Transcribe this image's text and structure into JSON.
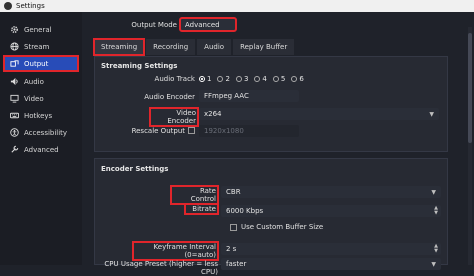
{
  "window": {
    "title": "Settings"
  },
  "sidebar": {
    "items": [
      {
        "label": "General",
        "icon": "gear-icon"
      },
      {
        "label": "Stream",
        "icon": "globe-icon"
      },
      {
        "label": "Output",
        "icon": "output-icon"
      },
      {
        "label": "Audio",
        "icon": "speaker-icon"
      },
      {
        "label": "Video",
        "icon": "monitor-icon"
      },
      {
        "label": "Hotkeys",
        "icon": "keyboard-icon"
      },
      {
        "label": "Accessibility",
        "icon": "accessibility-icon"
      },
      {
        "label": "Advanced",
        "icon": "wrench-icon"
      }
    ],
    "active_index": 2
  },
  "output_mode": {
    "label": "Output Mode",
    "value": "Advanced"
  },
  "tabs": [
    {
      "label": "Streaming"
    },
    {
      "label": "Recording"
    },
    {
      "label": "Audio"
    },
    {
      "label": "Replay Buffer"
    }
  ],
  "streaming_settings": {
    "title": "Streaming Settings",
    "audio_track": {
      "label": "Audio Track",
      "options": [
        "1",
        "2",
        "3",
        "4",
        "5",
        "6"
      ],
      "selected": "1"
    },
    "audio_encoder": {
      "label": "Audio Encoder",
      "value": "FFmpeg AAC"
    },
    "video_encoder": {
      "label": "Video Encoder",
      "value": "x264"
    },
    "rescale_output": {
      "label": "Rescale Output",
      "checked": false,
      "value": "1920x1080"
    }
  },
  "encoder_settings": {
    "title": "Encoder Settings",
    "rate_control": {
      "label": "Rate Control",
      "value": "CBR"
    },
    "bitrate": {
      "label": "Bitrate",
      "value": "6000 Kbps"
    },
    "custom_buffer": {
      "label": "Use Custom Buffer Size",
      "checked": false
    },
    "keyframe_interval": {
      "label": "Keyframe Interval (0=auto)",
      "value": "2 s"
    },
    "cpu_preset": {
      "label": "CPU Usage Preset (higher = less CPU)",
      "value": "faster"
    }
  },
  "colors": {
    "accent": "#284cb8",
    "highlight": "#e0252b",
    "background": "#1f222a"
  }
}
